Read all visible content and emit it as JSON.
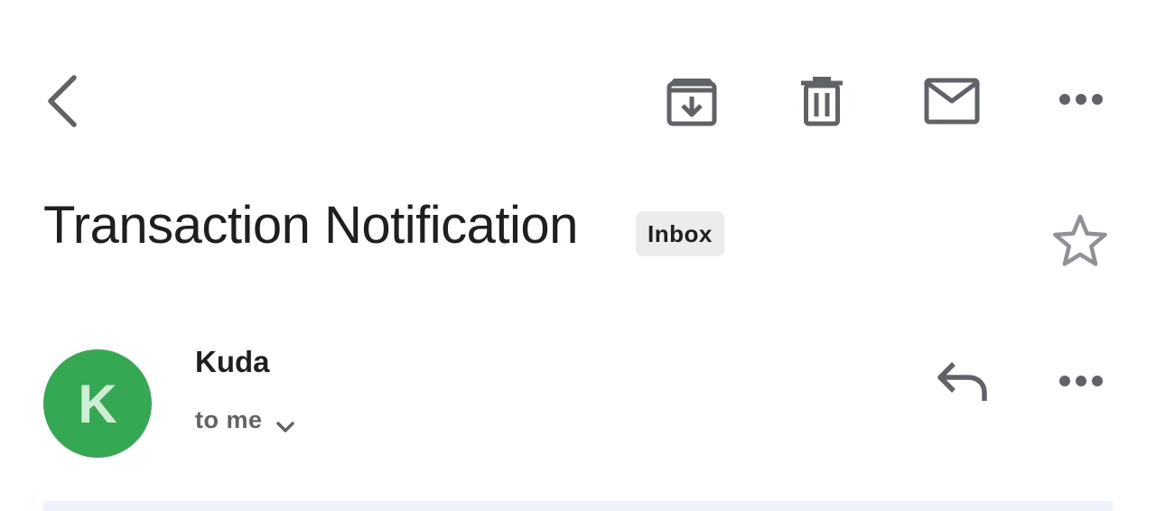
{
  "toolbar": {
    "back": "back-icon",
    "archive": "archive-icon",
    "delete": "delete-icon",
    "mark_unread": "mail-icon",
    "more": "more-icon"
  },
  "email": {
    "subject": "Transaction Notification",
    "label": "Inbox",
    "starred": false,
    "sender": {
      "name": "Kuda",
      "initial": "K",
      "avatar_color": "#34a853"
    },
    "recipient": "to me"
  },
  "colors": {
    "icon": "#5f6368",
    "text": "#1f1f1f",
    "chip_bg": "#ececec",
    "body_band": "#eef2fb"
  }
}
